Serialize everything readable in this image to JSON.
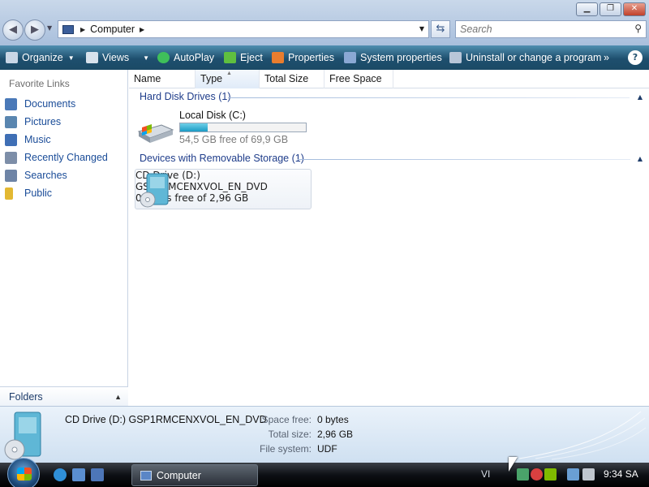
{
  "window": {
    "controls": {
      "minimize": "▁",
      "maximize": "❐",
      "close": "✕"
    },
    "back_glyph": "◀",
    "forward_glyph": "▶"
  },
  "address": {
    "crumb": "Computer"
  },
  "search": {
    "placeholder": "Search"
  },
  "toolbar": {
    "items": [
      {
        "label": "Organize",
        "icon": "organize-icon",
        "has_dropdown": true
      },
      {
        "label": "Views",
        "icon": "views-icon",
        "has_dropdown": true
      },
      {
        "label": "AutoPlay",
        "icon": "autoplay-icon",
        "has_dropdown": false
      },
      {
        "label": "Eject",
        "icon": "eject-icon",
        "has_dropdown": false
      },
      {
        "label": "Properties",
        "icon": "properties-icon",
        "has_dropdown": false
      },
      {
        "label": "System properties",
        "icon": "system-properties-icon",
        "has_dropdown": false
      },
      {
        "label": "Uninstall or change a program",
        "icon": "uninstall-icon",
        "has_dropdown": false
      }
    ],
    "more": "»",
    "help": "?"
  },
  "navpane": {
    "heading": "Favorite Links",
    "links": [
      {
        "label": "Documents",
        "icon": "documents-icon",
        "color": "#4a79b8"
      },
      {
        "label": "Pictures",
        "icon": "pictures-icon",
        "color": "#5a86b0"
      },
      {
        "label": "Music",
        "icon": "music-icon",
        "color": "#3f6fb5"
      },
      {
        "label": "Recently Changed",
        "icon": "recently-changed-icon",
        "color": "#7d8ea8"
      },
      {
        "label": "Searches",
        "icon": "searches-icon",
        "color": "#6e84a6"
      },
      {
        "label": "Public",
        "icon": "public-folder-icon",
        "color": "#e3b832"
      }
    ],
    "folders_label": "Folders"
  },
  "columns": [
    "Name",
    "Type",
    "Total Size",
    "Free Space"
  ],
  "groups": {
    "hard_disks": "Hard Disk Drives (1)",
    "removable": "Devices with Removable Storage (1)"
  },
  "drives": {
    "local": {
      "name": "Local Disk (C:)",
      "free_text": "54,5 GB free of 69,9 GB",
      "used_fraction": 0.22
    },
    "cd": {
      "name": "CD Drive (D:)",
      "label": "GSP1RMCENXVOL_EN_DVD",
      "free_text": "0 bytes free of 2,96 GB"
    }
  },
  "details": {
    "title": "CD Drive (D:) GSP1RMCENXVOL_EN_DVD",
    "fields": [
      {
        "label": "Space free:",
        "value": "0 bytes"
      },
      {
        "label": "Total size:",
        "value": "2,96 GB"
      },
      {
        "label": "File system:",
        "value": "UDF"
      }
    ]
  },
  "taskbar": {
    "active_window": "Computer",
    "language": "VI",
    "clock": "9:34 SA"
  },
  "colors": {
    "toolbar": "#1e4f6e",
    "link": "#1a4c98",
    "group": "#1e3c8a",
    "storage_bar": "#1b9bc4"
  }
}
